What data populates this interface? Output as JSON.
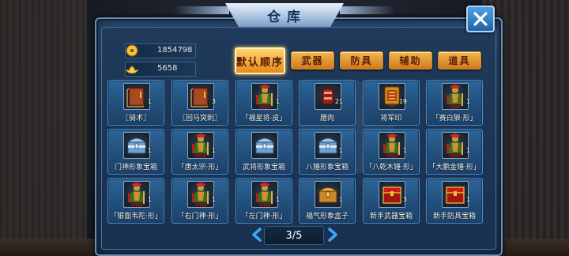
{
  "title": "仓库",
  "currency": {
    "gold": {
      "icon": "gold-coin-icon",
      "value": "1854798"
    },
    "ingot": {
      "icon": "gold-ingot-icon",
      "value": "5658"
    }
  },
  "tabs": [
    {
      "label": "默认顺序",
      "active": true
    },
    {
      "label": "武器",
      "active": false
    },
    {
      "label": "防具",
      "active": false
    },
    {
      "label": "辅助",
      "active": false
    },
    {
      "label": "道具",
      "active": false
    }
  ],
  "items": [
    {
      "name": "〖骑术〗",
      "qty": "1",
      "icon": "book-icon"
    },
    {
      "name": "〖回马突刺〗",
      "qty": "3",
      "icon": "book-icon"
    },
    {
      "name": "「福星将·皮」",
      "qty": "1",
      "icon": "general-figure-icon"
    },
    {
      "name": "腊肉",
      "qty": "21",
      "icon": "cured-meat-icon"
    },
    {
      "name": "将军印",
      "qty": "19",
      "icon": "general-seal-icon"
    },
    {
      "name": "「赛白狼·形」",
      "qty": "1",
      "icon": "general-figure-icon"
    },
    {
      "name": "门神形象宝箱",
      "qty": "1",
      "icon": "silver-chest-icon"
    },
    {
      "name": "「唐太宗·形」",
      "qty": "1",
      "icon": "general-figure-icon"
    },
    {
      "name": "武将形象宝箱",
      "qty": "",
      "icon": "silver-chest-icon"
    },
    {
      "name": "八锤形象宝箱",
      "qty": "1",
      "icon": "silver-chest-icon"
    },
    {
      "name": "「八乾木锤·形」",
      "qty": "1",
      "icon": "general-figure-icon"
    },
    {
      "name": "「大鹏金锤·形」",
      "qty": "1",
      "icon": "general-figure-icon"
    },
    {
      "name": "「银面韦陀·形」",
      "qty": "1",
      "icon": "general-figure-icon"
    },
    {
      "name": "「右门神·形」",
      "qty": "1",
      "icon": "general-figure-icon"
    },
    {
      "name": "「左门神·形」",
      "qty": "1",
      "icon": "general-figure-icon"
    },
    {
      "name": "福气形象盒子",
      "qty": "1",
      "icon": "gold-chest-icon"
    },
    {
      "name": "新手武器宝箱",
      "qty": "3",
      "icon": "red-chest-icon"
    },
    {
      "name": "新手防具宝箱",
      "qty": "1",
      "icon": "red-chest-icon"
    }
  ],
  "pagination": {
    "label": "3/5"
  },
  "colors": {
    "accent_orange": "#e28a1a",
    "panel_blue": "#214d79",
    "title_text": "#12365c"
  }
}
